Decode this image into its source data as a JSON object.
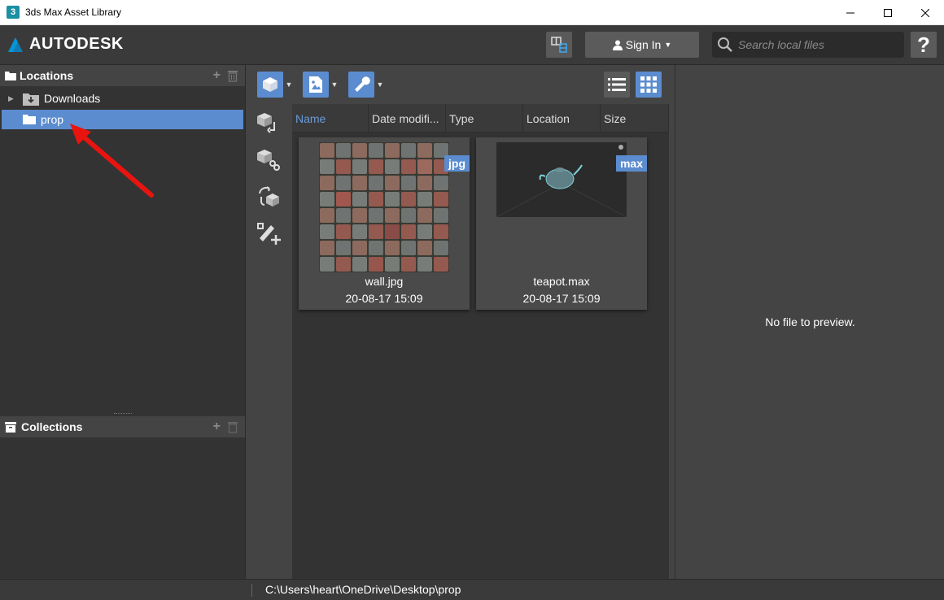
{
  "window": {
    "title": "3ds Max Asset Library",
    "app_icon_text": "3"
  },
  "header": {
    "brand": "AUTODESK",
    "signin_label": "Sign In",
    "search_placeholder": "Search local files",
    "help_label": "?"
  },
  "locations": {
    "title": "Locations",
    "items": [
      {
        "label": "Downloads",
        "expanded": false
      },
      {
        "label": "prop",
        "selected": true
      }
    ]
  },
  "collections": {
    "title": "Collections"
  },
  "columns": [
    "Name",
    "Date modifi...",
    "Type",
    "Location",
    "Size"
  ],
  "files": [
    {
      "name": "wall.jpg",
      "date": "20-08-17 15:09",
      "type": "jpg"
    },
    {
      "name": "teapot.max",
      "date": "20-08-17 15:09",
      "type": "max"
    }
  ],
  "preview": {
    "message": "No file to preview."
  },
  "status": {
    "path": "C:\\Users\\heart\\OneDrive\\Desktop\\prop"
  },
  "colors": {
    "accent": "#5b8ccf",
    "annotation_arrow": "#e8140f"
  }
}
